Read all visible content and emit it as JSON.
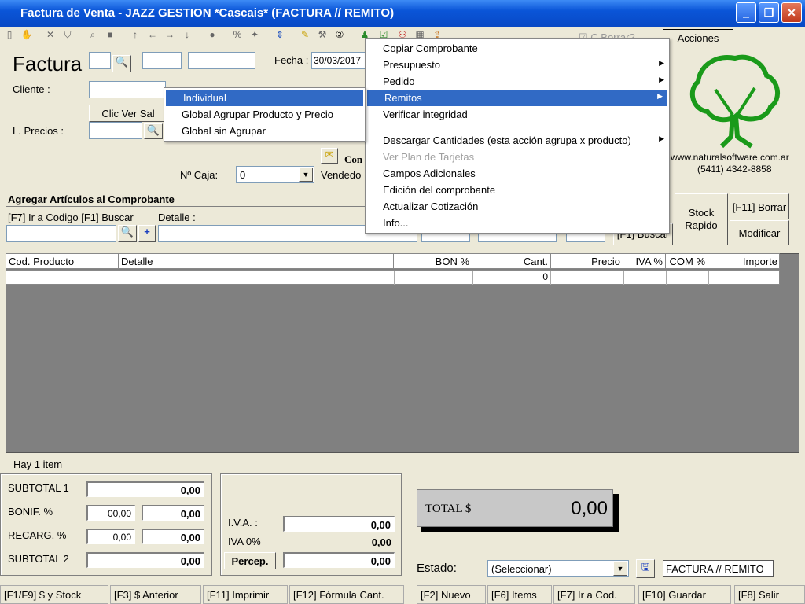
{
  "window": {
    "title": "Factura de Venta - JAZZ GESTION *Cascais* (FACTURA // REMITO)"
  },
  "header": {
    "doc_label": "Factura",
    "fecha_label": "Fecha :",
    "fecha_value": "30/03/2017",
    "cliente_label": "Cliente :",
    "clic_ver": "Clic Ver Sal",
    "lprecios_label": "L. Precios :",
    "ncaja_label": "Nº Caja:",
    "ncaja_value": "0",
    "vendedor_label": "Vendedo",
    "con_label": "Con",
    "cborrar_label": "C.Borrar?",
    "acciones_label": "Acciones"
  },
  "brand": {
    "url": "www.naturalsoftware.com.ar",
    "phone": "(5411) 4342-8858"
  },
  "add_section": {
    "title": "Agregar Artículos al Comprobante",
    "code_label": "[F7] Ir a Codigo [F1] Buscar",
    "detalle_label": "Detalle :",
    "buscar_btn": "[F1] Buscar",
    "stock_btn": "Stock\nRapido",
    "borrar_btn": "[F11] Borrar",
    "modificar_btn": "Modificar"
  },
  "grid": {
    "columns": [
      "Cod. Producto",
      "Detalle",
      "BON %",
      "Cant.",
      "Precio",
      "IVA %",
      "COM %",
      "Importe"
    ],
    "row_cant": "0",
    "item_count": "Hay 1 item"
  },
  "totals": {
    "subtotal1_label": "SUBTOTAL 1",
    "subtotal1": "0,00",
    "bonif_label": "BONIF. %",
    "bonif_pct": "00,00",
    "bonif_val": "0,00",
    "recarg_label": "RECARG. %",
    "recarg_pct": "0,00",
    "recarg_val": "0,00",
    "subtotal2_label": "SUBTOTAL 2",
    "subtotal2": "0,00",
    "iva_label": "I.V.A. :",
    "iva": "0,00",
    "iva0_label": "IVA 0%",
    "iva0": "0,00",
    "percep_label": "Percep.",
    "percep": "0,00",
    "total_label": "TOTAL $",
    "total": "0,00"
  },
  "estado": {
    "label": "Estado:",
    "value": "(Seleccionar)",
    "doc_type": "FACTURA // REMITO"
  },
  "menu": {
    "items": [
      {
        "label": "Copiar Comprobante"
      },
      {
        "label": "Presupuesto"
      },
      {
        "label": "Pedido"
      },
      {
        "label": "Remitos"
      },
      {
        "label": "Verificar integridad"
      },
      {
        "label": "Descargar Cantidades (esta acción agrupa x producto)"
      },
      {
        "label": "Ver Plan de Tarjetas"
      },
      {
        "label": "Campos Adicionales"
      },
      {
        "label": "Edición del comprobante"
      },
      {
        "label": "Actualizar Cotización"
      },
      {
        "label": "Info..."
      }
    ]
  },
  "submenu": {
    "items": [
      {
        "label": "Individual"
      },
      {
        "label": "Global Agrupar Producto y Precio"
      },
      {
        "label": "Global sin Agrupar"
      }
    ]
  },
  "statusbar": [
    "[F1/F9] $ y Stock",
    "[F3] $ Anterior",
    "[F11] Imprimir",
    "[F12] Fórmula Cant.",
    "[F2] Nuevo",
    "[F6] Items",
    "[F7] Ir a Cod.",
    "[F10] Guardar",
    "[F8] Salir"
  ],
  "colors": {
    "title_bar": "#0a55d8",
    "selection": "#316ac5",
    "grid_bg": "#808080",
    "brand_green": "#1a9a1a"
  }
}
